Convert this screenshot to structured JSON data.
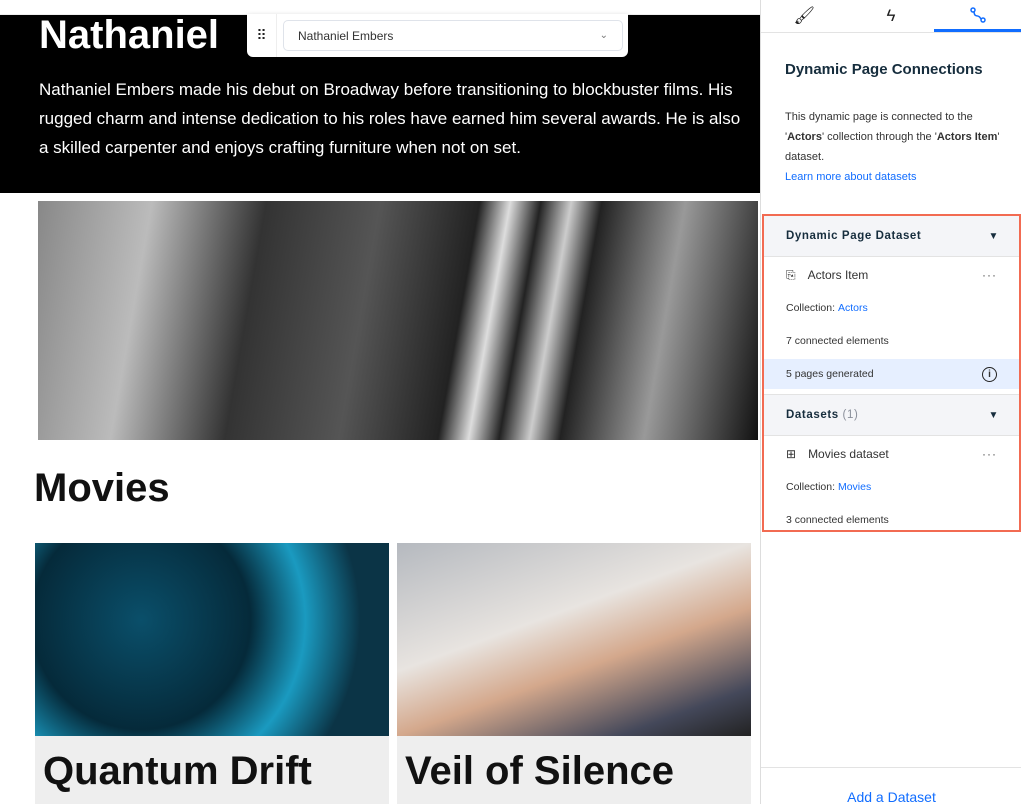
{
  "canvas": {
    "actor_name": "Nathaniel",
    "actor_bio": "Nathaniel Embers made his debut on Broadway before transitioning to blockbuster films. His rugged charm and intense dedication to his roles have earned him several awards. He is also a skilled carpenter and enjoys crafting furniture when not on set.",
    "item_selector": {
      "value": "Nathaniel Embers"
    },
    "movies_heading": "Movies",
    "movies": [
      {
        "title": "Quantum Drift"
      },
      {
        "title": "Veil of Silence"
      }
    ]
  },
  "panel": {
    "tabs": [
      {
        "icon": "brush-icon"
      },
      {
        "icon": "lightning-icon"
      },
      {
        "icon": "connections-icon",
        "active": true
      }
    ],
    "title": "Dynamic Page Connections",
    "desc_1": "This dynamic page is connected to the '",
    "desc_actors": "Actors",
    "desc_2": "' collection through the '",
    "desc_item": "Actors Item",
    "desc_3": "' dataset.",
    "learn_more": "Learn more about datasets",
    "dynamic_section": {
      "title": "Dynamic Page Dataset",
      "dataset": "Actors Item",
      "collection_label": "Collection: ",
      "collection": "Actors",
      "connected": "7 connected elements",
      "pages": "5 pages generated"
    },
    "datasets_section": {
      "title": "Datasets",
      "count": "(1)",
      "dataset": "Movies dataset",
      "collection_label": "Collection: ",
      "collection": "Movies",
      "connected": "3 connected elements"
    },
    "add_dataset": "Add a Dataset",
    "highlight_color": "#f26b52",
    "accent_color": "#116dff"
  }
}
